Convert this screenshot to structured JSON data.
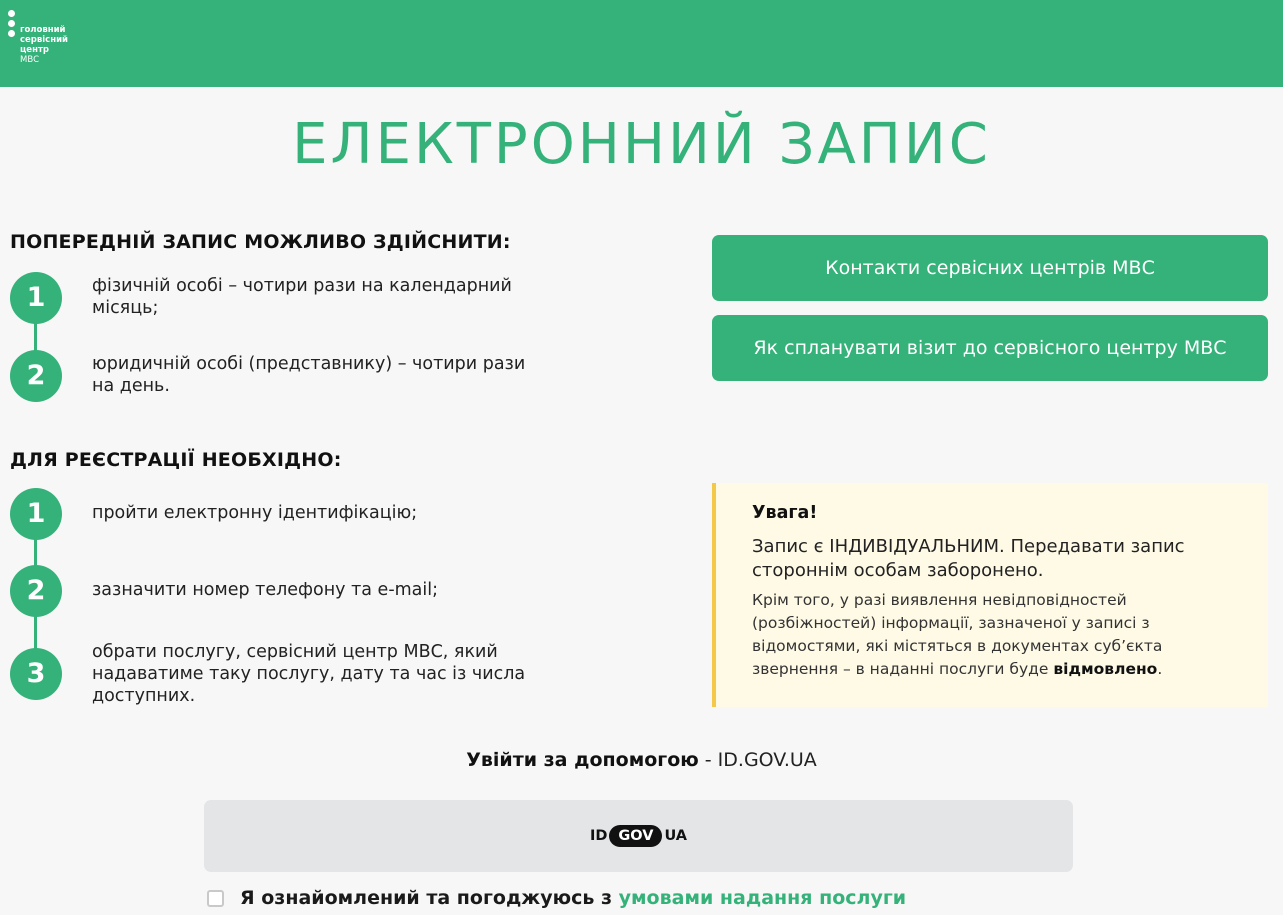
{
  "header": {
    "logo_lines": [
      "головний",
      "сервісний",
      "центр"
    ],
    "logo_sub": "МВС"
  },
  "title": "ЕЛЕКТРОННИЙ ЗАПИС",
  "prior": {
    "heading": "ПОПЕРЕДНІЙ ЗАПИС МОЖЛИВО ЗДІЙСНИТИ:",
    "steps": [
      {
        "num": "1",
        "text": "фізичній особі – чотири рази на календарний місяць;"
      },
      {
        "num": "2",
        "text": "юридичній особі (представнику) – чотири рази на день."
      }
    ]
  },
  "registration": {
    "heading": "ДЛЯ РЕЄСТРАЦІЇ НЕОБХІДНО:",
    "steps": [
      {
        "num": "1",
        "text": "пройти електронну ідентифікацію;"
      },
      {
        "num": "2",
        "text": "зазначити номер телефону та e-mail;"
      },
      {
        "num": "3",
        "text": "обрати послугу, сервісний центр МВС, який надаватиме таку послугу, дату та час із числа доступних."
      }
    ]
  },
  "buttons": {
    "contacts": "Контакти сервісних центрів МВС",
    "plan_visit": "Як спланувати візит до сервісного центру МВС"
  },
  "notice": {
    "title": "Увага!",
    "main": "Запис є ІНДИВІДУАЛЬНИМ. Передавати запис стороннім особам заборонено.",
    "sub": "Крім того, у разі виявлення невідповідностей (розбіжностей) інформації, зазначеної у записі з відомостями, які містяться в документах суб’єкта звернення – в наданні послуги буде",
    "sub_bold": "відмовлено",
    "sub_end": "."
  },
  "login": {
    "label_bold": "Увійти за допомогою",
    "label_rest": " - ID.GOV.UA",
    "logo_left": "ID",
    "logo_mid": "GOV",
    "logo_right": "UA"
  },
  "consent": {
    "text": "Я ознайомлений та погоджуюсь з ",
    "link": "умовами надання послуги",
    "checked": false
  },
  "colors": {
    "brand_green": "#34b279",
    "notice_bg": "#fefae6",
    "notice_border": "#f4c94a"
  }
}
